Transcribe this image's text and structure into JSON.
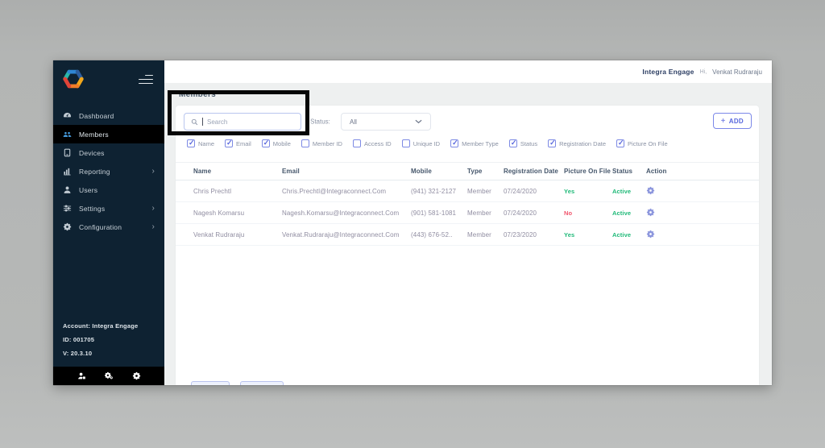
{
  "header": {
    "brand": "Integra Engage",
    "greeting": "Hi,",
    "user": "Venkat Rudraraju"
  },
  "sidebar": {
    "items": [
      {
        "label": "Dashboard",
        "icon": "dashboard-icon",
        "active": false,
        "chevron": false
      },
      {
        "label": "Members",
        "icon": "members-icon",
        "active": true,
        "chevron": false
      },
      {
        "label": "Devices",
        "icon": "devices-icon",
        "active": false,
        "chevron": false
      },
      {
        "label": "Reporting",
        "icon": "reporting-icon",
        "active": false,
        "chevron": true
      },
      {
        "label": "Users",
        "icon": "users-icon",
        "active": false,
        "chevron": false
      },
      {
        "label": "Settings",
        "icon": "settings-icon",
        "active": false,
        "chevron": true
      },
      {
        "label": "Configuration",
        "icon": "configuration-icon",
        "active": false,
        "chevron": true
      }
    ],
    "account": "Account: Integra Engage",
    "account_id": "ID: 001705",
    "version": "V: 20.3.10",
    "bottom_icons": [
      "user-settings-icon",
      "gears-icon",
      "gear-icon"
    ]
  },
  "page": {
    "title": "Members",
    "search_placeholder": "Search",
    "status_label": "Status:",
    "status_value": "All",
    "add_button": "ADD"
  },
  "filters": [
    {
      "label": "Name",
      "checked": true
    },
    {
      "label": "Email",
      "checked": true
    },
    {
      "label": "Mobile",
      "checked": true
    },
    {
      "label": "Member ID",
      "checked": false
    },
    {
      "label": "Access ID",
      "checked": false
    },
    {
      "label": "Unique ID",
      "checked": false
    },
    {
      "label": "Member Type",
      "checked": true
    },
    {
      "label": "Status",
      "checked": true
    },
    {
      "label": "Registration Date",
      "checked": true
    },
    {
      "label": "Picture On File",
      "checked": true
    }
  ],
  "table": {
    "columns": [
      "Name",
      "Email",
      "Mobile",
      "Type",
      "Registration Date",
      "Picture On File",
      "Status",
      "Action"
    ],
    "rows": [
      {
        "name": "Chris Prechtl",
        "email": "Chris.Prechtl@Integraconnect.Com",
        "mobile": "(941) 321-2127",
        "type": "Member",
        "registration_date": "07/24/2020",
        "picture_on_file": "Yes",
        "status": "Active"
      },
      {
        "name": "Nagesh Komarsu",
        "email": "Nagesh.Komarsu@Integraconnect.Com",
        "mobile": "(901) 581-1081",
        "type": "Member",
        "registration_date": "07/24/2020",
        "picture_on_file": "No",
        "status": "Active"
      },
      {
        "name": "Venkat Rudraraju",
        "email": "Venkat.Rudraraju@Integraconnect.Com",
        "mobile": "(443) 676-52..",
        "type": "Member",
        "registration_date": "07/23/2020",
        "picture_on_file": "Yes",
        "status": "Active"
      }
    ]
  },
  "colors": {
    "accent": "#5867dd",
    "green": "#1fb978",
    "red": "#f1556c",
    "sidebar_bg": "#0e2232",
    "active_item_bg": "#000000",
    "members_icon_blue": "#4aa3e8"
  }
}
